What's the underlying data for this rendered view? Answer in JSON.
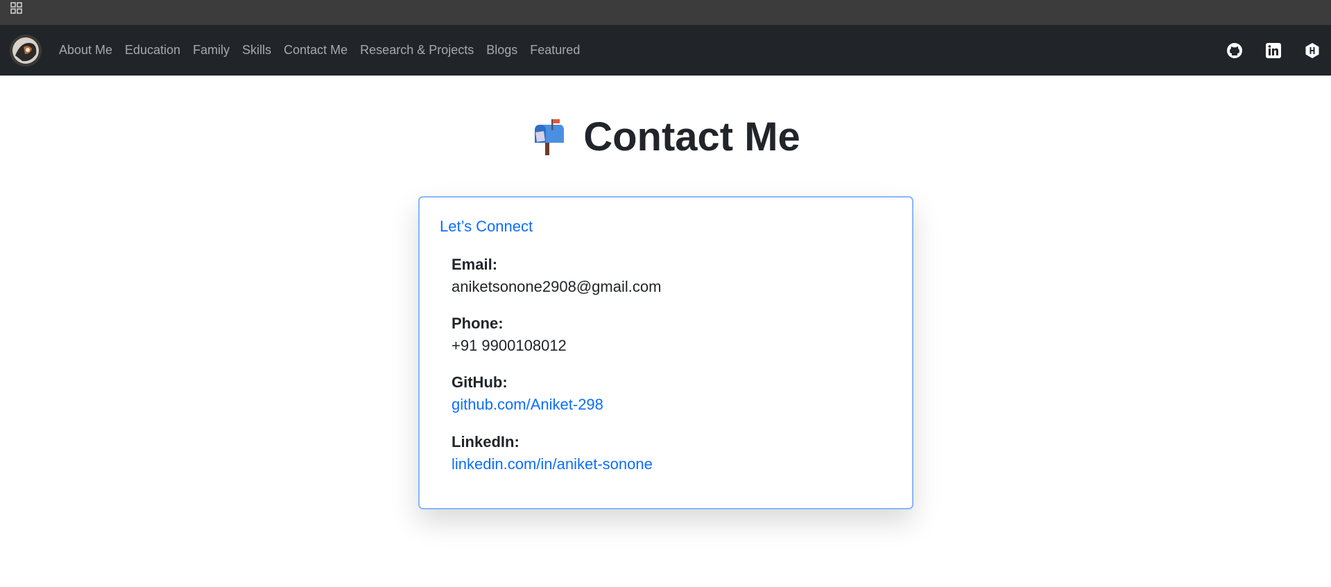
{
  "nav": {
    "links": [
      "About Me",
      "Education",
      "Family",
      "Skills",
      "Contact Me",
      "Research & Projects",
      "Blogs",
      "Featured"
    ],
    "icons": [
      "github-icon",
      "linkedin-icon",
      "hashnode-icon"
    ]
  },
  "page": {
    "title": "Contact Me",
    "title_icon": "mailbox-icon"
  },
  "card": {
    "title": "Let’s Connect",
    "email_label": "Email:",
    "email_value": "aniketsonone2908@gmail.com",
    "phone_label": "Phone:",
    "phone_value": "+91 9900108012",
    "github_label": "GitHub:",
    "github_value": "github.com/Aniket-298",
    "linkedin_label": "LinkedIn:",
    "linkedin_value": "linkedin.com/in/aniket-sonone"
  },
  "colors": {
    "navbar": "#212529",
    "accent": "#0d6efd",
    "card_border": "#86b7fe"
  }
}
